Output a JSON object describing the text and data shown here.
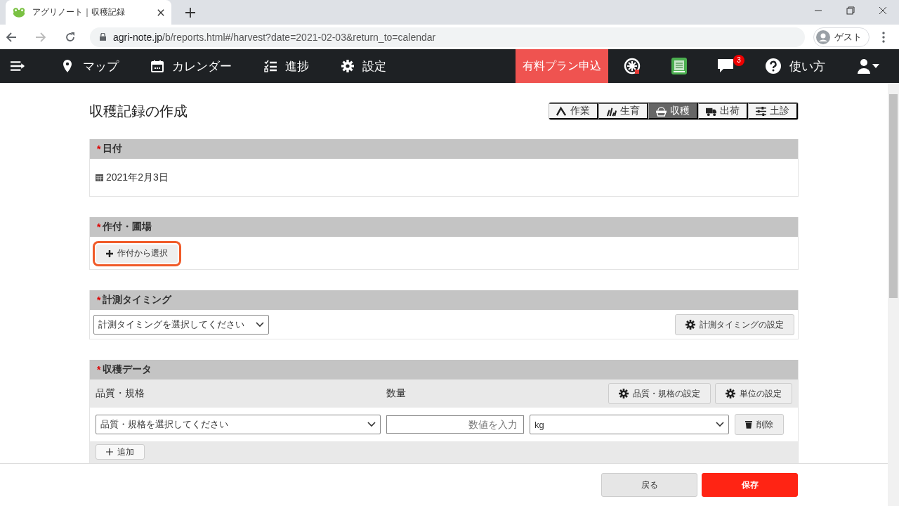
{
  "browser": {
    "tab_title": "アグリノート｜収穫記録",
    "url": "agri-note.jp/b/reports.html#/harvest?date=2021-02-03&return_to=calendar",
    "profile": "ゲスト"
  },
  "navbar": {
    "items": [
      "マップ",
      "カレンダー",
      "進捗",
      "設定"
    ],
    "paid_plan": "有料プラン申込",
    "notification_count": "3",
    "help": "使い方"
  },
  "page": {
    "title": "収穫記録の作成",
    "report_tabs": [
      {
        "label": "作業",
        "selected": false
      },
      {
        "label": "生育",
        "selected": false
      },
      {
        "label": "収穫",
        "selected": true
      },
      {
        "label": "出荷",
        "selected": false
      },
      {
        "label": "土診",
        "selected": false
      }
    ],
    "sections": [
      {
        "kind": "date",
        "title": "日付",
        "required_mark": "*",
        "value": "2021年2月3日"
      },
      {
        "kind": "crop",
        "title": "作付・圃場",
        "required_mark": "*",
        "button": "作付から選択",
        "highlighted": true
      },
      {
        "kind": "timing",
        "title": "計測タイミング",
        "required_mark": "*",
        "value": "計測タイミングを選択してください",
        "button": "計測タイミングの設定"
      },
      {
        "kind": "harvest",
        "title": "収穫データ",
        "required_mark": "*",
        "columns": [
          "品質・規格",
          "数量"
        ],
        "settings_buttons": [
          "品質・規格の設定",
          "単位の設定"
        ],
        "rows": [
          {
            "quality": "品質・規格を選択してください",
            "quantity_placeholder": "数値を入力",
            "unit": "kg",
            "delete": "削除"
          }
        ],
        "add_button": "追加"
      }
    ]
  },
  "footer": {
    "back": "戻る",
    "save": "保存"
  }
}
